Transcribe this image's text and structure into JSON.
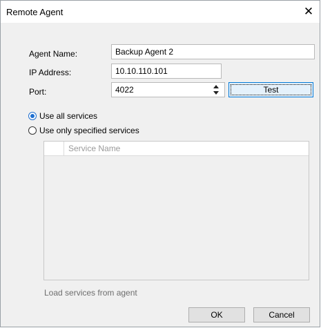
{
  "window": {
    "title": "Remote Agent",
    "close_glyph": "✕"
  },
  "form": {
    "agent_name_label": "Agent Name:",
    "agent_name_value": "Backup Agent 2",
    "ip_label": "IP Address:",
    "ip_value": "10.10.110.101",
    "port_label": "Port:",
    "port_value": "4022",
    "test_label": "Test"
  },
  "services": {
    "use_all_label": "Use all services",
    "use_all_checked": true,
    "use_specified_label": "Use only specified services",
    "use_specified_checked": false,
    "table_header": "Service Name",
    "load_link": "Load services from agent"
  },
  "buttons": {
    "ok": "OK",
    "cancel": "Cancel"
  },
  "colors": {
    "accent": "#1e6fd0",
    "focus_border": "#0078d7"
  }
}
